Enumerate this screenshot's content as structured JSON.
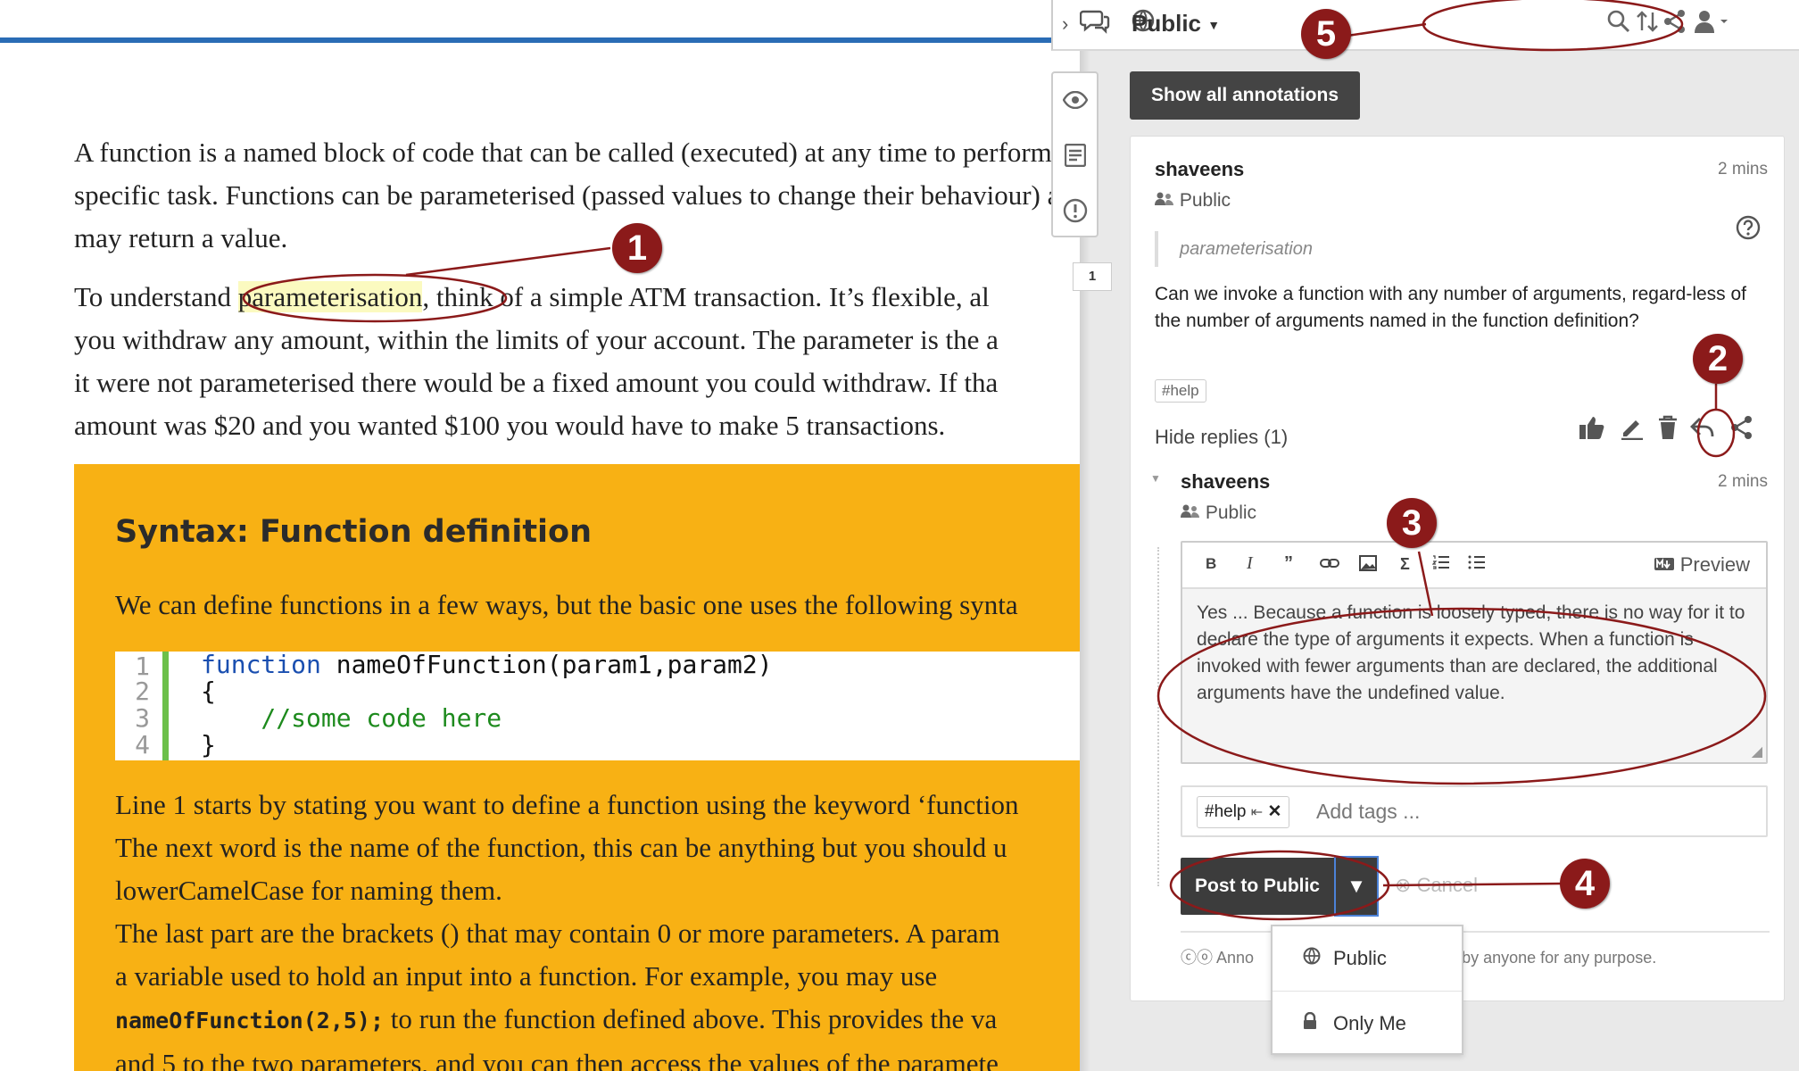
{
  "document": {
    "paragraph1": [
      "A function is a named block of code that can be called (executed) at any time to perform",
      "specific task. Functions can be parameterised (passed values to change their behaviour) an",
      "may return a value."
    ],
    "paragraph2": {
      "line1_before": "To understand ",
      "line1_highlight": "parameterisation",
      "line1_after": ", think of a simple ATM transaction. It’s flexible, al",
      "line2": "you withdraw any amount, within the limits of your account. The parameter is the a",
      "line3": "it were not parameterised there would be a fixed amount you could withdraw. If tha",
      "line4": "amount was $20 and you wanted $100 you would have to make 5 transactions."
    },
    "syntax": {
      "title": "Syntax: Function definition",
      "intro": "We can define functions in a few ways, but the basic one uses the following synta",
      "code_lines": [
        {
          "num": "1",
          "keyword": "function",
          "rest": " nameOfFunction(param1,param2)"
        },
        {
          "num": "2",
          "keyword": "",
          "rest": "{"
        },
        {
          "num": "3",
          "keyword": "",
          "rest": "    //some code here"
        },
        {
          "num": "4",
          "keyword": "",
          "rest": "}"
        }
      ],
      "explain": [
        "Line 1 starts by stating you want to define a function using the keyword ‘function",
        "The next word is the name of the function, this can be anything but you should u",
        "lowerCamelCase for naming them.",
        "The last part are the brackets () that may contain 0 or more parameters. A param",
        "a variable used to hold an input into a function. For example, you may use"
      ],
      "inline_code": "nameOfFunction(2,5);",
      "after_code": " to run the function defined above. This provides the va",
      "last_line": "and 5 to the two parameters, and you can then access the values of the paramete"
    }
  },
  "sidebar": {
    "group_label": "Public",
    "show_all_label": "Show all annotations",
    "tool_count": "1",
    "annotation": {
      "user": "shaveens",
      "time": "2 mins",
      "privacy": "Public",
      "quote": "parameterisation",
      "body": "Can we invoke a function with any number of arguments, regard-less of the number of arguments named in the function definition?",
      "tag": "#help",
      "hide_replies": "Hide replies (1)"
    },
    "reply": {
      "user": "shaveens",
      "time": "2 mins",
      "privacy": "Public",
      "preview_label": "Preview",
      "text": "Yes ... Because a function is loosely typed, there is no way for it to declare the type of arguments it expects. When a function is invoked with fewer arguments than are declared, the additional arguments have the undefined value.",
      "tag": "#help",
      "add_tags_placeholder": "Add tags ...",
      "post_label": "Post to Public",
      "cancel_label": "Cancel",
      "license_left": "Anno",
      "license_right": "d by anyone for any purpose."
    },
    "dropdown": [
      {
        "label": "Public",
        "icon": "globe-icon"
      },
      {
        "label": "Only Me",
        "icon": "lock-icon"
      }
    ]
  },
  "markers": [
    "1",
    "2",
    "3",
    "4",
    "5"
  ],
  "colors": {
    "accent_blue": "#2a6cb5",
    "syntax_bg": "#f8b114",
    "marker": "#8b1a1a",
    "highlight": "#fbfac0"
  }
}
